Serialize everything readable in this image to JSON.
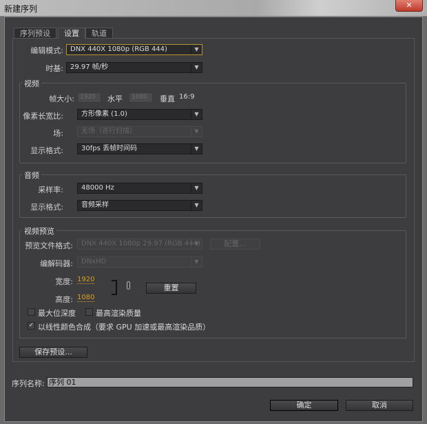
{
  "window": {
    "title": "新建序列",
    "close_icon": "✕"
  },
  "tabs": [
    {
      "label": "序列预设"
    },
    {
      "label": "设置"
    },
    {
      "label": "轨道"
    }
  ],
  "active_tab": "设置",
  "settings": {
    "edit_mode": {
      "label": "编辑模式:",
      "value": "DNX 440X 1080p (RGB 444)"
    },
    "timebase": {
      "label": "时基:",
      "value": "29.97 帧/秒"
    }
  },
  "video": {
    "title": "视频",
    "frame_size": {
      "label": "帧大小:",
      "width": "1920",
      "horizontal": "水平",
      "height": "1080",
      "vertical": "垂直",
      "aspect": "16:9"
    },
    "pixel_aspect": {
      "label": "像素长宽比:",
      "value": "方形像素 (1.0)"
    },
    "field": {
      "label": "场:",
      "value": "无场（逐行扫描）"
    },
    "display_format": {
      "label": "显示格式:",
      "value": "30fps 丢帧时间码"
    }
  },
  "audio": {
    "title": "音频",
    "sample_rate": {
      "label": "采样率:",
      "value": "48000 Hz"
    },
    "display_format": {
      "label": "显示格式:",
      "value": "音频采样"
    }
  },
  "preview": {
    "title": "视频预览",
    "file_format": {
      "label": "预览文件格式:",
      "value": "DNX 440X 1080p 29.97 (RGB 444)"
    },
    "configure": "配置...",
    "codec": {
      "label": "编解码器:",
      "value": "DNxHD"
    },
    "width": {
      "label": "宽度:",
      "value": "1920"
    },
    "height": {
      "label": "高度:",
      "value": "1080"
    },
    "reset": "重置",
    "max_bit_depth": {
      "label": "最大位深度",
      "checked": false
    },
    "max_render_quality": {
      "label": "最高渲染质量",
      "checked": false
    },
    "linear_color": {
      "label": "以线性颜色合成（要求 GPU 加速或最高渲染品质）",
      "checked": true,
      "check_mark": "✓"
    }
  },
  "save_preset": "保存预设...",
  "sequence_name": {
    "label": "序列名称:",
    "value": "序列 01"
  },
  "ok": "确定",
  "cancel": "取消",
  "colors": {
    "accent": "#d9a021",
    "focus_border": "#b8942e",
    "background": "#3d3c3e"
  }
}
